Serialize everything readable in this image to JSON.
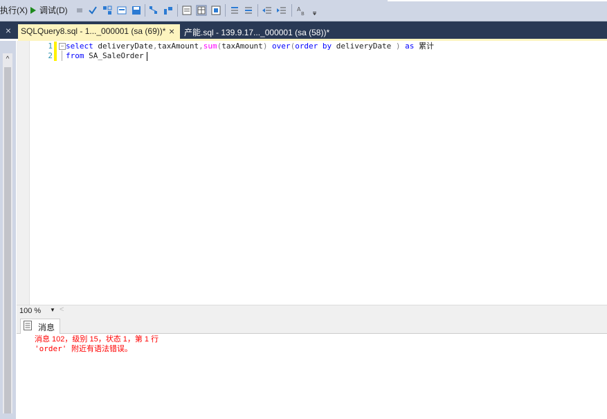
{
  "toolbar": {
    "execute_label": "执行(X)",
    "debug_label": "调试(D)"
  },
  "tabs": [
    {
      "label": "SQLQuery8.sql - 1..._000001 (sa (69))*",
      "close": "×"
    },
    {
      "label": "产能.sql - 139.9.17..._000001 (sa (58))*"
    }
  ],
  "left_close": "×",
  "editor": {
    "lines": [
      {
        "number": "1",
        "parts": [
          {
            "t": "select",
            "c": "kw"
          },
          {
            "t": " deliveryDate",
            "c": "id"
          },
          {
            "t": ",",
            "c": "op"
          },
          {
            "t": "taxAmount",
            "c": "id"
          },
          {
            "t": ",",
            "c": "op"
          },
          {
            "t": "sum",
            "c": "fn"
          },
          {
            "t": "(",
            "c": "op"
          },
          {
            "t": "taxAmount",
            "c": "id"
          },
          {
            "t": ")",
            "c": "op"
          },
          {
            "t": " over",
            "c": "kw"
          },
          {
            "t": "(",
            "c": "op"
          },
          {
            "t": "order by",
            "c": "kw"
          },
          {
            "t": " deliveryDate ",
            "c": "id"
          },
          {
            "t": ")",
            "c": "op"
          },
          {
            "t": " as",
            "c": "kw"
          },
          {
            "t": " 累计",
            "c": "id"
          }
        ]
      },
      {
        "number": "2",
        "parts": [
          {
            "t": "from",
            "c": "kw"
          },
          {
            "t": " SA_SaleOrder ",
            "c": "id"
          }
        ]
      }
    ]
  },
  "zoom": {
    "value": "100 %"
  },
  "results": {
    "tab_label": "消息",
    "messages": [
      "消息 102，级别 15，状态 1，第 1 行",
      "'order' 附近有语法错误。"
    ]
  },
  "colors": {
    "keyword": "#0000ff",
    "function": "#ff00ff",
    "error": "#ff0000",
    "active_tab": "#fdf4bf",
    "tabstrip": "#293955"
  }
}
